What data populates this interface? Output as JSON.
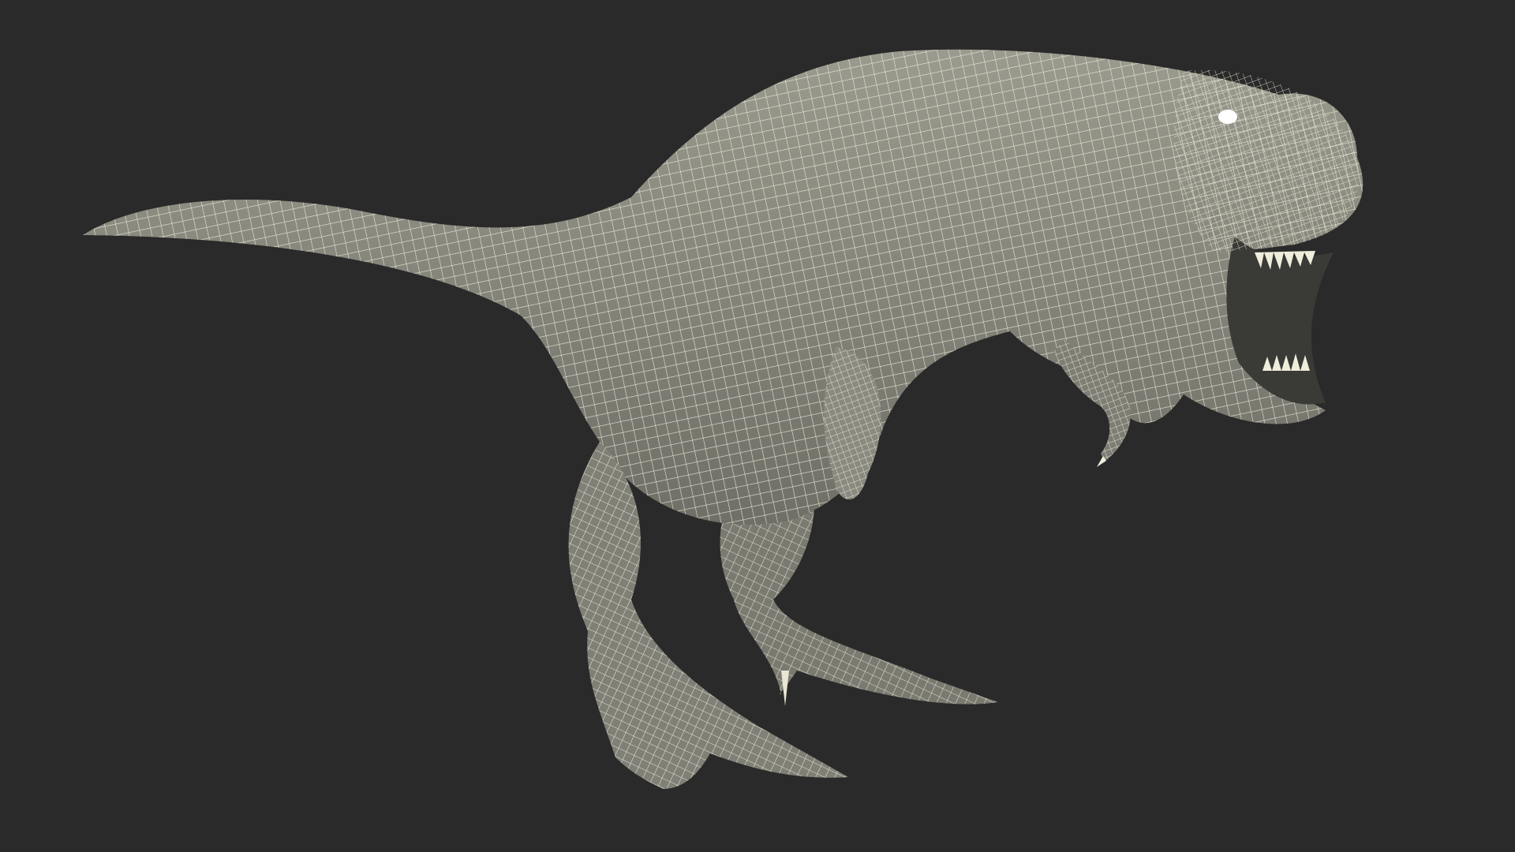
{
  "scene": {
    "subject": "t-rex-wireframe-model",
    "background_color": "#2a2a2a",
    "mesh_fill_color": "#8c8c80",
    "mesh_shadow_color": "#5f605a",
    "wire_color": "#f2f0de",
    "eye_color": "#ffffff",
    "teeth_color": "#efeddc",
    "mouth_color": "#3a3a36"
  }
}
